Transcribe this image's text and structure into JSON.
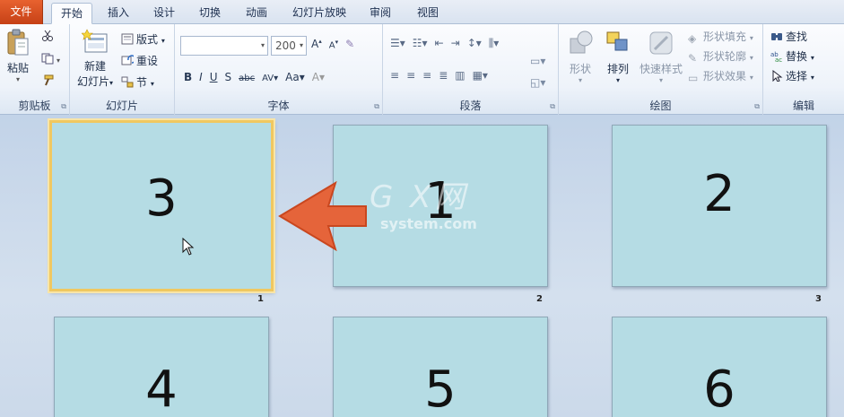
{
  "tabs": [
    "文件",
    "开始",
    "插入",
    "设计",
    "切换",
    "动画",
    "幻灯片放映",
    "审阅",
    "视图"
  ],
  "clipboard": {
    "paste": "粘贴",
    "label": "剪贴板"
  },
  "slides_group": {
    "new_slide_l1": "新建",
    "new_slide_l2": "幻灯片",
    "layout": "版式",
    "reset": "重设",
    "section": "节",
    "label": "幻灯片"
  },
  "font": {
    "size_value": "200",
    "label": "字体"
  },
  "paragraph": {
    "label": "段落"
  },
  "drawing": {
    "shapes": "形状",
    "arrange": "排列",
    "quick_styles": "快速样式",
    "shape_fill": "形状填充",
    "shape_outline": "形状轮廓",
    "shape_effects": "形状效果",
    "label": "绘图"
  },
  "editing": {
    "find": "查找",
    "replace": "替换",
    "select": "选择",
    "label": "编辑"
  },
  "slides": [
    {
      "content": "3",
      "index": "1",
      "selected": true
    },
    {
      "content": "1",
      "index": "2",
      "selected": false
    },
    {
      "content": "2",
      "index": "3",
      "selected": false
    },
    {
      "content": "4",
      "index": "",
      "selected": false
    },
    {
      "content": "5",
      "index": "",
      "selected": false
    },
    {
      "content": "6",
      "index": "",
      "selected": false
    }
  ],
  "watermark": {
    "brand": "G X网",
    "domain": "system.com"
  },
  "colors": {
    "accent_file_tab": "#d9501f",
    "slide_fill": "#b5dce4",
    "selection": "#f0c860",
    "arrow": "#e5643a"
  },
  "icons": [
    "paste-icon",
    "cut-icon",
    "copy-icon",
    "format-painter-icon",
    "new-slide-icon",
    "find-icon",
    "replace-icon",
    "select-icon",
    "mouse-cursor-icon",
    "left-arrow-icon"
  ]
}
